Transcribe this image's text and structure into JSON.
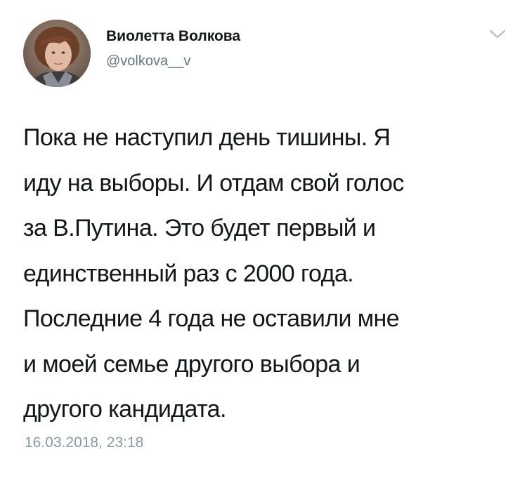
{
  "author": {
    "display_name": "Виолетта Волкова",
    "handle": "@volkova__v"
  },
  "tweet": {
    "text": "Пока не наступил день тишины. Я\nиду на выборы. И отдам свой голос\nза В.Путина. Это будет первый и\nединственный раз с 2000 года.\nПоследние 4 года не оставили мне\nи моей семье другого выбора и\nдругого кандидата.",
    "timestamp": "16.03.2018, 23:18"
  },
  "icons": {
    "menu": "chevron-down-icon",
    "avatar": "avatar"
  },
  "colors": {
    "text": "#14171a",
    "secondary_text": "#657786",
    "timestamp": "#8899a6",
    "chevron": "#aab8c2",
    "background": "#ffffff"
  }
}
